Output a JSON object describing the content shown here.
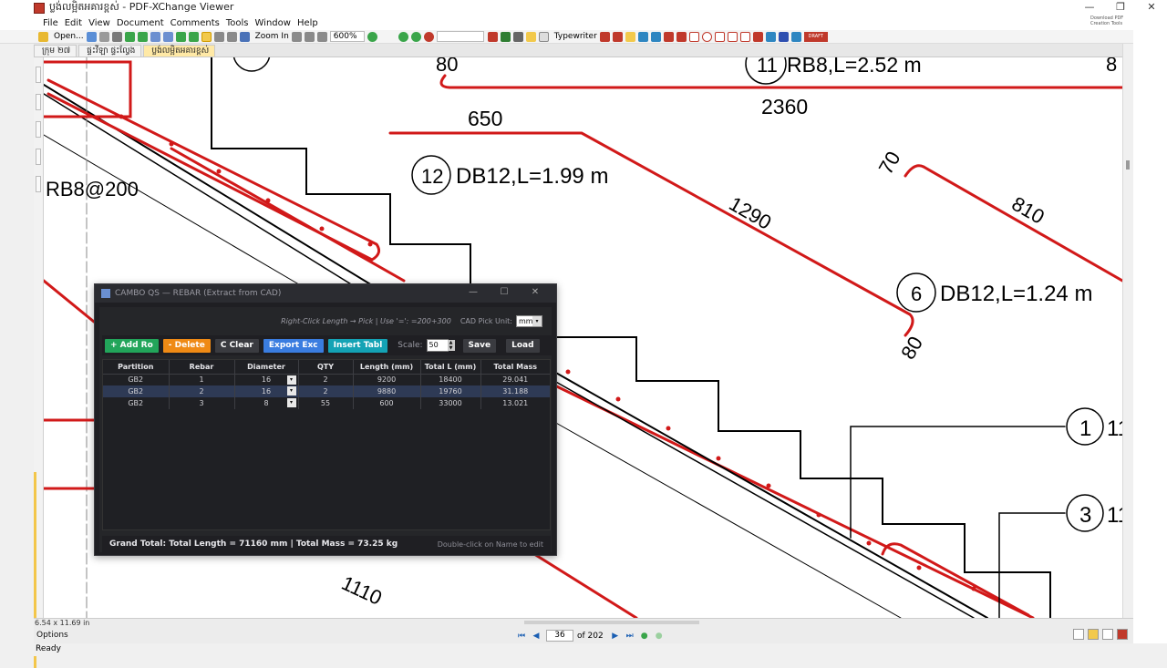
{
  "window": {
    "title": "ប្លង់លម្អិតអគារខ្ពស់ - PDF-XChange Viewer",
    "controls": [
      "—",
      "❐",
      "✕"
    ]
  },
  "menu": [
    "File",
    "Edit",
    "View",
    "Document",
    "Comments",
    "Tools",
    "Window",
    "Help"
  ],
  "promo_text": "Download PDF Creation Tools",
  "toolbar": {
    "open_label": "Open...",
    "zoom_in_label": "Zoom In",
    "zoom_value": "600%",
    "typewriter_label": "Typewriter",
    "draft_label": "DRAFT"
  },
  "tabs": [
    {
      "label": "ក្រុម ២៧",
      "active": false
    },
    {
      "label": "ផ្ទះវីឡា ផ្ទះល្វែង",
      "active": false
    },
    {
      "label": "ប្លង់លម្អិតអគារខ្ពស់",
      "active": true
    }
  ],
  "drawing": {
    "labels": {
      "top_left": "RB8@200",
      "dim_80_top": "80",
      "bar11": "RB8,L=2.52 m",
      "bar11_no": "11",
      "dim_2360": "2360",
      "dim_650": "650",
      "bar12_no": "12",
      "bar12": "DB12,L=1.99 m",
      "dim_1290": "1290",
      "dim_70": "70",
      "dim_810": "810",
      "bar6_no": "6",
      "bar6": "DB12,L=1.24 m",
      "dim_80_right": "80",
      "callout_1": "1",
      "callout_1_text": "11",
      "callout_3": "3",
      "callout_3_text": "11",
      "dim_1110": "1110",
      "dim_80_far": "8"
    },
    "colors": {
      "rebar": "#d11919",
      "line": "#000000"
    }
  },
  "dialog": {
    "title": "CAMBO QS — REBAR (Extract from CAD)",
    "hint": "Right-Click Length → Pick | Use '=': =200+300",
    "unit_label": "CAD Pick Unit:",
    "unit_value": "mm",
    "buttons": {
      "add": "+ Add Ro",
      "delete": "- Delete",
      "clear": "C Clear",
      "export": "Export Exc",
      "insert": "Insert Tabl",
      "save": "Save",
      "load": "Load"
    },
    "scale_label": "Scale:",
    "scale_value": "50",
    "columns": [
      "Partition",
      "Rebar",
      "Diameter",
      "QTY",
      "Length (mm)",
      "Total L (mm)",
      "Total Mass"
    ],
    "rows": [
      {
        "partition": "GB2",
        "rebar": "1",
        "diameter": "16",
        "qty": "2",
        "length": "9200",
        "total_l": "18400",
        "mass": "29.041",
        "selected": false
      },
      {
        "partition": "GB2",
        "rebar": "2",
        "diameter": "16",
        "qty": "2",
        "length": "9880",
        "total_l": "19760",
        "mass": "31.188",
        "selected": true
      },
      {
        "partition": "GB2",
        "rebar": "3",
        "diameter": "8",
        "qty": "55",
        "length": "600",
        "total_l": "33000",
        "mass": "13.021",
        "selected": false
      }
    ],
    "grand_total": "Grand Total: Total Length = 71160 mm  |  Total Mass = 73.25 kg",
    "edit_hint": "Double-click on Name to edit"
  },
  "bottom": {
    "page_size": "6.54 x 11.69 in",
    "options_label": "Options",
    "page_number": "36",
    "page_of": "of 202"
  },
  "status": "Ready"
}
